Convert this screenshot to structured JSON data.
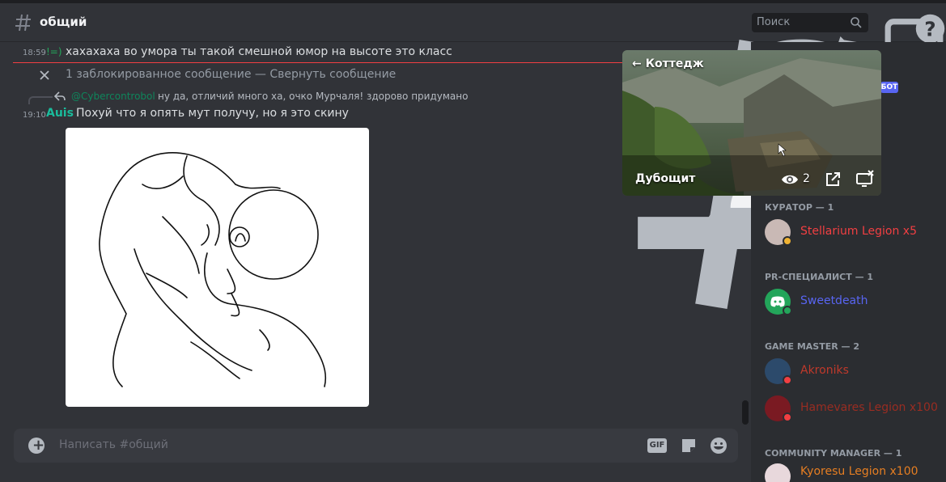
{
  "header": {
    "channel_name": "общий",
    "search_placeholder": "Поиск"
  },
  "messages": {
    "msg1": {
      "time": "18:59",
      "prefix": "!=)",
      "text": "хахахаха во умора ты такой смешной юмор на высоте это класс"
    },
    "blocked": {
      "text": "1 заблокированное сообщение — ",
      "collapse": "Свернуть сообщение"
    },
    "reply": {
      "mention": "@Cybercontrobol",
      "text": "ну да, отличий много ха, очко Мурчаля! здорово придумано"
    },
    "msg2": {
      "time": "19:10",
      "author": "Auis",
      "text": "Похуй что я опять мут получу, но я это скину"
    }
  },
  "composer": {
    "placeholder": "Написать #общий",
    "gif_label": "GIF"
  },
  "stream_popout": {
    "back_label": "← Коттедж",
    "streamer": "Дубощит",
    "viewers": "2"
  },
  "members": {
    "bot_tag": "БОТ",
    "groups": [
      {
        "title": "КУРАТОР — 1",
        "name": "Stellarium Legion x5",
        "color": "#f23f42"
      },
      {
        "title": "PR-СПЕЦИАЛИСТ — 1",
        "name": "Sweetdeath",
        "color": "#5865f2"
      },
      {
        "title": "GAME MASTER — 2",
        "name": "Akroniks",
        "color": "#c0392b"
      },
      {
        "title": "",
        "name": "Hamevares Legion x100",
        "color": "#992d22"
      },
      {
        "title": "COMMUNITY MANAGER — 1",
        "name": "Kyoresu Legion x100",
        "color": "#e67e22"
      }
    ]
  },
  "colors": {
    "accent": "#5865f2",
    "author": "#1abc9c",
    "new_line": "#f23f42",
    "status_online": "#23a55a",
    "status_dnd": "#f23f42"
  },
  "icons": [
    "hash-icon",
    "threads-icon",
    "bell-icon",
    "pin-icon",
    "members-icon",
    "search-icon",
    "inbox-icon",
    "help-icon",
    "close-icon",
    "reply-icon",
    "add-icon",
    "sticker-icon",
    "emoji-icon",
    "eye-icon",
    "popout-icon",
    "stop-stream-icon"
  ]
}
